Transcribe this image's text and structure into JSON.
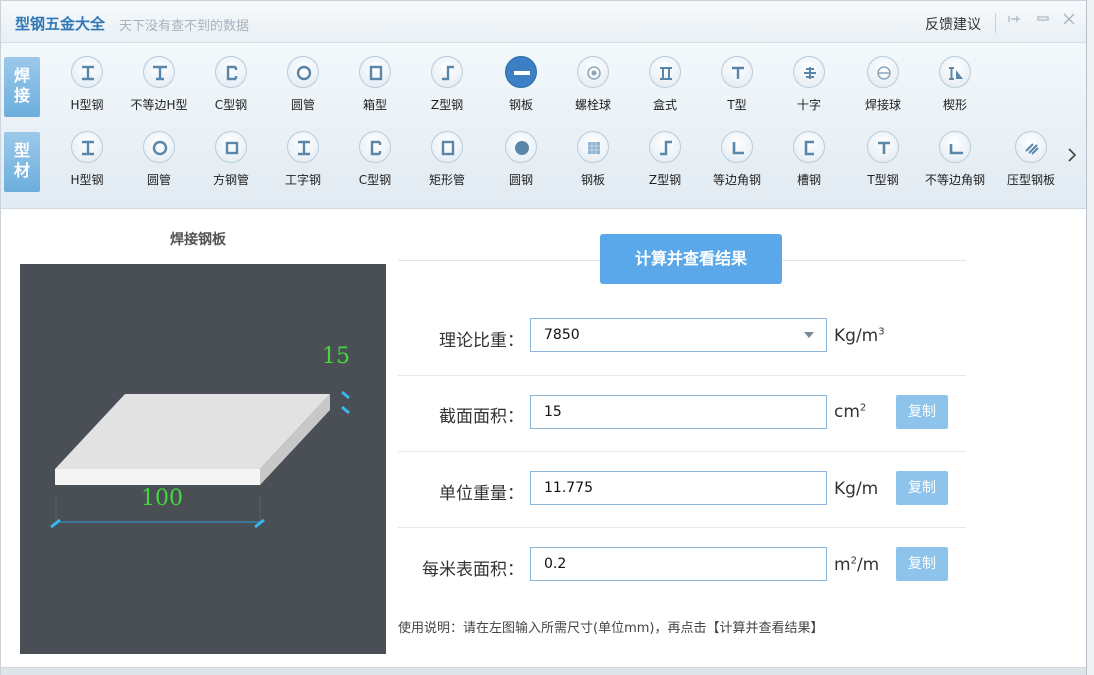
{
  "header": {
    "title": "型钢五金大全",
    "slogan": "天下没有查不到的数据",
    "feedback": "反馈建议"
  },
  "groups": {
    "weld": "焊接",
    "profile": "型材"
  },
  "weld_tools": [
    {
      "label": "H型钢",
      "icon": "h-beam-icon"
    },
    {
      "label": "不等边H型",
      "icon": "unequal-h-beam-icon"
    },
    {
      "label": "C型钢",
      "icon": "c-channel-icon"
    },
    {
      "label": "圆管",
      "icon": "round-tube-icon"
    },
    {
      "label": "箱型",
      "icon": "box-section-icon"
    },
    {
      "label": "Z型钢",
      "icon": "z-section-icon"
    },
    {
      "label": "钢板",
      "icon": "steel-plate-icon"
    },
    {
      "label": "螺栓球",
      "icon": "bolt-ball-icon"
    },
    {
      "label": "盒式",
      "icon": "box-type-icon"
    },
    {
      "label": "T型",
      "icon": "t-section-icon"
    },
    {
      "label": "十字",
      "icon": "cross-section-icon"
    },
    {
      "label": "焊接球",
      "icon": "weld-ball-icon"
    },
    {
      "label": "楔形",
      "icon": "wedge-icon"
    }
  ],
  "profile_tools": [
    {
      "label": "H型钢",
      "icon": "h-beam-icon"
    },
    {
      "label": "圆管",
      "icon": "round-tube-icon"
    },
    {
      "label": "方钢管",
      "icon": "square-tube-icon"
    },
    {
      "label": "工字钢",
      "icon": "i-beam-icon"
    },
    {
      "label": "C型钢",
      "icon": "c-channel-icon"
    },
    {
      "label": "矩形管",
      "icon": "rect-tube-icon"
    },
    {
      "label": "圆钢",
      "icon": "round-bar-icon"
    },
    {
      "label": "钢板",
      "icon": "steel-plate-icon"
    },
    {
      "label": "Z型钢",
      "icon": "z-section-icon"
    },
    {
      "label": "等边角钢",
      "icon": "equal-angle-icon"
    },
    {
      "label": "槽钢",
      "icon": "channel-icon"
    },
    {
      "label": "T型钢",
      "icon": "t-section-icon"
    },
    {
      "label": "不等边角钢",
      "icon": "unequal-angle-icon"
    },
    {
      "label": "压型钢板",
      "icon": "profiled-sheet-icon"
    }
  ],
  "active_tool": "钢板",
  "left_panel": {
    "title": "焊接钢板",
    "thickness": "15",
    "width": "100"
  },
  "calc_button": "计算并查看结果",
  "fields": {
    "density": {
      "label": "理论比重：",
      "value": "7850",
      "unit_main": "Kg/m",
      "unit_sup": "3"
    },
    "area": {
      "label": "截面面积：",
      "value": "15",
      "unit_main": "cm",
      "unit_sup": "2",
      "copy": "复制"
    },
    "unit_weight": {
      "label": "单位重量：",
      "value": "11.775",
      "unit_main": "Kg/m",
      "copy": "复制"
    },
    "surface": {
      "label": "每米表面积：",
      "value": "0.2",
      "unit_pre": "m",
      "unit_sup": "2",
      "unit_post": "/m",
      "copy": "复制"
    }
  },
  "help_text": "使用说明：请在左图输入所需尺寸(单位mm)，再点击【计算并查看结果】",
  "colors": {
    "accent": "#5aa7ea",
    "title": "#2f78b8",
    "dimension": "#43d63f",
    "diagram_bg": "#4a4f56"
  }
}
